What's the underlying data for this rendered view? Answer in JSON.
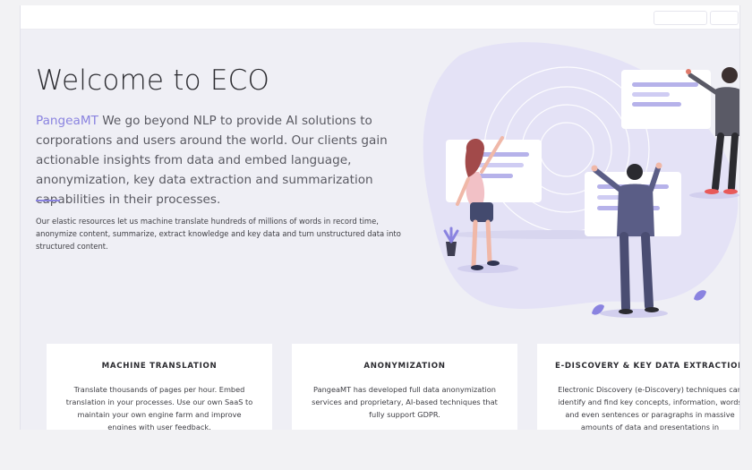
{
  "hero": {
    "title": "Welcome to ECO",
    "brand": "PangeaMT",
    "lead": " We go beyond NLP to provide AI solutions to corporations and users around the world. Our clients gain actionable insights from data and embed language, anonymization, key data extraction and summarization capabilities in their processes.",
    "subtext": "Our elastic resources let us machine translate hundreds of millions of words in record time, anonymize content, summarize, extract knowledge and key data and turn unstructured data into structured content."
  },
  "cards": [
    {
      "title": "MACHINE TRANSLATION",
      "text": "Translate thousands of pages per hour. Embed translation in your processes. Use our own SaaS to maintain your own engine farm and improve engines with user feedback."
    },
    {
      "title": "ANONYMIZATION",
      "text": "PangeaMT has developed full data anonymization services and proprietary, AI-based techniques that fully support GDPR."
    },
    {
      "title": "E-DISCOVERY & KEY DATA EXTRACTION",
      "text": "Electronic Discovery (e-Discovery) techniques can identify and find key concepts, information, words and even sentences or paragraphs in massive amounts of data and presentations in"
    }
  ],
  "colors": {
    "accent": "#8a83e0",
    "background": "#efeff5",
    "blob": "#e4e2f6"
  }
}
